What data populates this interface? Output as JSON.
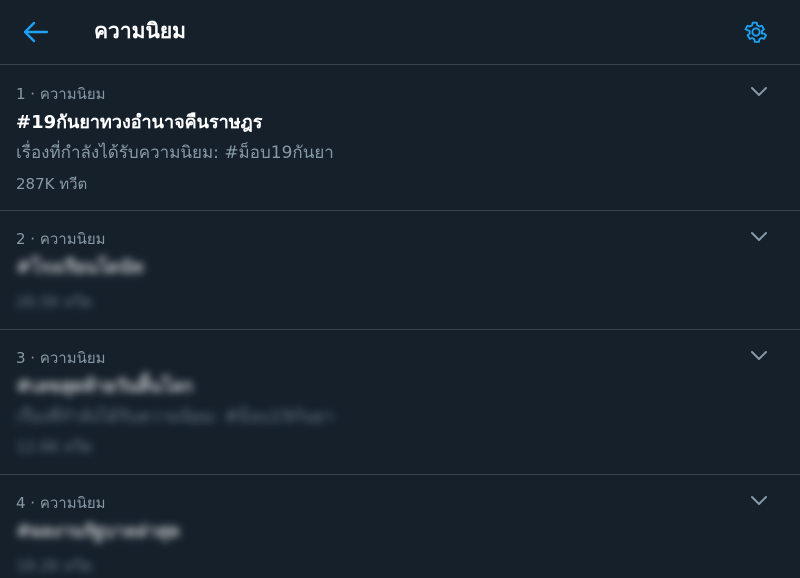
{
  "header": {
    "title": "ความนิยม",
    "back_icon": "arrow-left-icon",
    "settings_icon": "gear-icon",
    "accent_color": "#1da1f2"
  },
  "trends": [
    {
      "meta": "1 · ความนิยม",
      "name": "#19กันยาทวงอำนาจคืนราษฎร",
      "context": "เรื่องที่กำลังได้รับความนิยม: #ม็อบ19กันยา",
      "count": "287K ทวีต",
      "blurred": false
    },
    {
      "meta": "2 · ความนิยม",
      "name": "#โรงเรียนโดนัท",
      "count": "26.5K ทวีต",
      "blurred": true
    },
    {
      "meta": "3 · ความนิยม",
      "name": "#เลขสุดท้ายวันสิ้นโลก",
      "context": "เรื่องที่กำลังได้รับความนิยม: #ม็อบ19กันยา",
      "count": "12.6K ทวีต",
      "blurred": true
    },
    {
      "meta": "4 · ความนิยม",
      "name": "#ผลงานรัฐบาลล่าสุด",
      "count": "18.2K ทวีต",
      "blurred": true
    }
  ],
  "colors": {
    "background": "#15202b",
    "divider": "#38444d",
    "secondary_text": "#8899a6",
    "primary_text": "#ffffff"
  }
}
